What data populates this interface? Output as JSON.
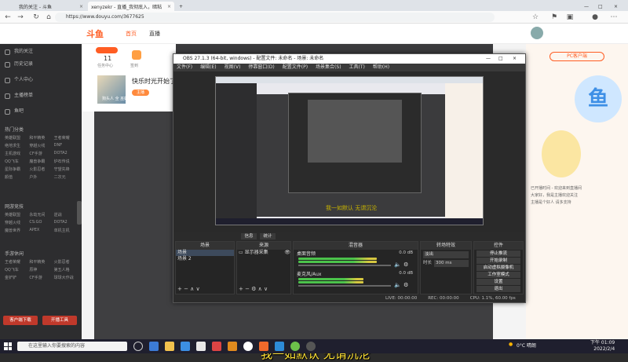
{
  "browser": {
    "tabs": [
      {
        "title": "我的关注 - 斗鱼",
        "active": false
      },
      {
        "title": "xenyzekr - 直播_我彻底入，暗粘",
        "active": true
      }
    ],
    "url": "https://www.douyu.com/3677625"
  },
  "site": {
    "logo": "斗鱼",
    "nav": [
      "首页",
      "直播"
    ],
    "sidebar": {
      "items": [
        "我的关注",
        "历史记录",
        "个人中心",
        "主播榜单",
        "鱼吧"
      ],
      "section1": "热门分类",
      "grid1": [
        "英雄联盟",
        "和平精英",
        "王者荣耀",
        "绝地求生",
        "穿越火线",
        "DNF",
        "主机游戏",
        "CF手游",
        "DOTA2",
        "QQ飞车",
        "魔兽争霸",
        "炉石传说",
        "星际争霸",
        "火影忍者",
        "守望先锋",
        "颜值",
        "户外",
        "二次元"
      ],
      "section2": "网游竞技",
      "grid2": [
        "英雄联盟",
        "永劫无间",
        "逆战",
        "穿越火线",
        "CS:GO",
        "DOTA2",
        "魔兽世界",
        "APEX",
        "单机主机"
      ],
      "section3": "手游休闲",
      "grid3": [
        "王者荣耀",
        "和平精英",
        "火影忍者",
        "QQ飞车",
        "原神",
        "第五人格",
        "金铲铲",
        "CF手游",
        "球球大作战"
      ],
      "btn_left": "客户端下载",
      "btn_right": "开播工具"
    },
    "stats": {
      "count": "11",
      "label1": "任务中心",
      "label2": "签到"
    },
    "room": {
      "title": "快乐时光开始了",
      "streamer": "狗头人 全 巫妖",
      "tag": "主播"
    },
    "right_panel": {
      "badge": "PC客户端",
      "mascot": "鱼",
      "desc_lines": [
        "已开播时间 - 欢迎来到直播间",
        "大家好，我是主播欢迎关注",
        "主播是个好人 请多支持"
      ]
    }
  },
  "obs": {
    "title": "OBS 27.1.3 (64-bit, windows) - 配置文件: 未命名 - 场景: 未命名",
    "menu": [
      "文件(F)",
      "编辑(E)",
      "视图(V)",
      "停靠窗口(D)",
      "配置文件(P)",
      "场景集合(S)",
      "工具(T)",
      "帮助(H)"
    ],
    "preview_subtitle": "我一如默认 无谓沉沦",
    "mode_tabs": [
      "信息",
      "统计"
    ],
    "scenes_header": "场景",
    "scenes": [
      "场景",
      "场景 2"
    ],
    "sources_header": "来源",
    "sources": [
      "显示器采集"
    ],
    "mixer_header": "混音器",
    "mixer_tracks": [
      {
        "name": "桌面音频",
        "db": "0.0 dB",
        "level": 0.85
      },
      {
        "name": "麦克风/Aux",
        "db": "0.0 dB",
        "level": 0.7
      }
    ],
    "transitions_header": "转场特效",
    "transition_type": "淡出",
    "duration_label": "时长",
    "duration": "300 ms",
    "controls_header": "控件",
    "controls": [
      "停止推流",
      "开始录制",
      "启动虚拟摄像机",
      "工作室模式",
      "设置",
      "退出"
    ],
    "status": {
      "live": "LIVE: 00:00:00",
      "rec": "REC: 00:00:00",
      "cpu": "CPU: 1.1%, 60.00 fps"
    }
  },
  "video_subtitle": "我一如默认 无谓沉沦",
  "taskbar": {
    "search_placeholder": "在这里输入你要搜索的内容",
    "weather": "0°C 晴朗",
    "time": "下午 01:09",
    "date": "2022/2/4"
  },
  "colors": {
    "obs_bg": "#2b2b2b",
    "accent": "#ff5d23",
    "subtitle": "#ffe234",
    "meter_green": "#4bc34b",
    "meter_yellow": "#d6c740"
  }
}
